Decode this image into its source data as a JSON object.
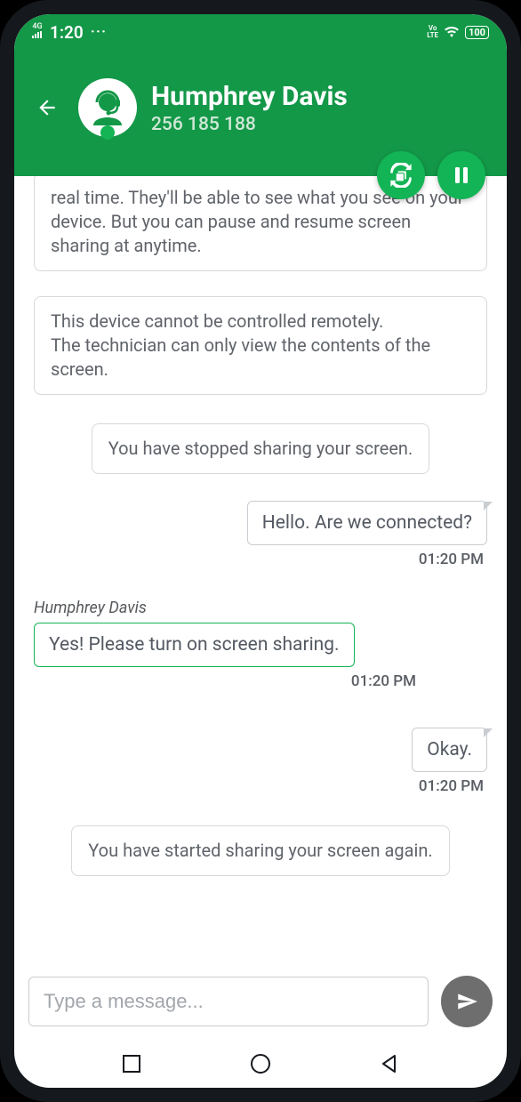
{
  "status": {
    "signal": "4G",
    "time": "1:20",
    "dots": "···",
    "volte": "VoLTE",
    "battery": "100"
  },
  "header": {
    "name": "Humphrey Davis",
    "phone": "256 185 188"
  },
  "system_messages": {
    "info1": "real time. They'll be able to see what you see on your device. But you can pause and resume screen sharing at anytime.",
    "info2_line1": "This device cannot be controlled remotely.",
    "info2_line2": "The technician can only view the contents of the screen.",
    "stopped": "You have stopped sharing your screen.",
    "started": "You have started sharing your screen again."
  },
  "messages": [
    {
      "side": "right",
      "text": "Hello. Are we connected?",
      "time": "01:20 PM"
    },
    {
      "side": "left",
      "sender": "Humphrey Davis",
      "text": "Yes! Please turn on screen sharing.",
      "time": "01:20 PM"
    },
    {
      "side": "right",
      "text": "Okay.",
      "time": "01:20 PM"
    }
  ],
  "composer": {
    "placeholder": "Type a message..."
  }
}
